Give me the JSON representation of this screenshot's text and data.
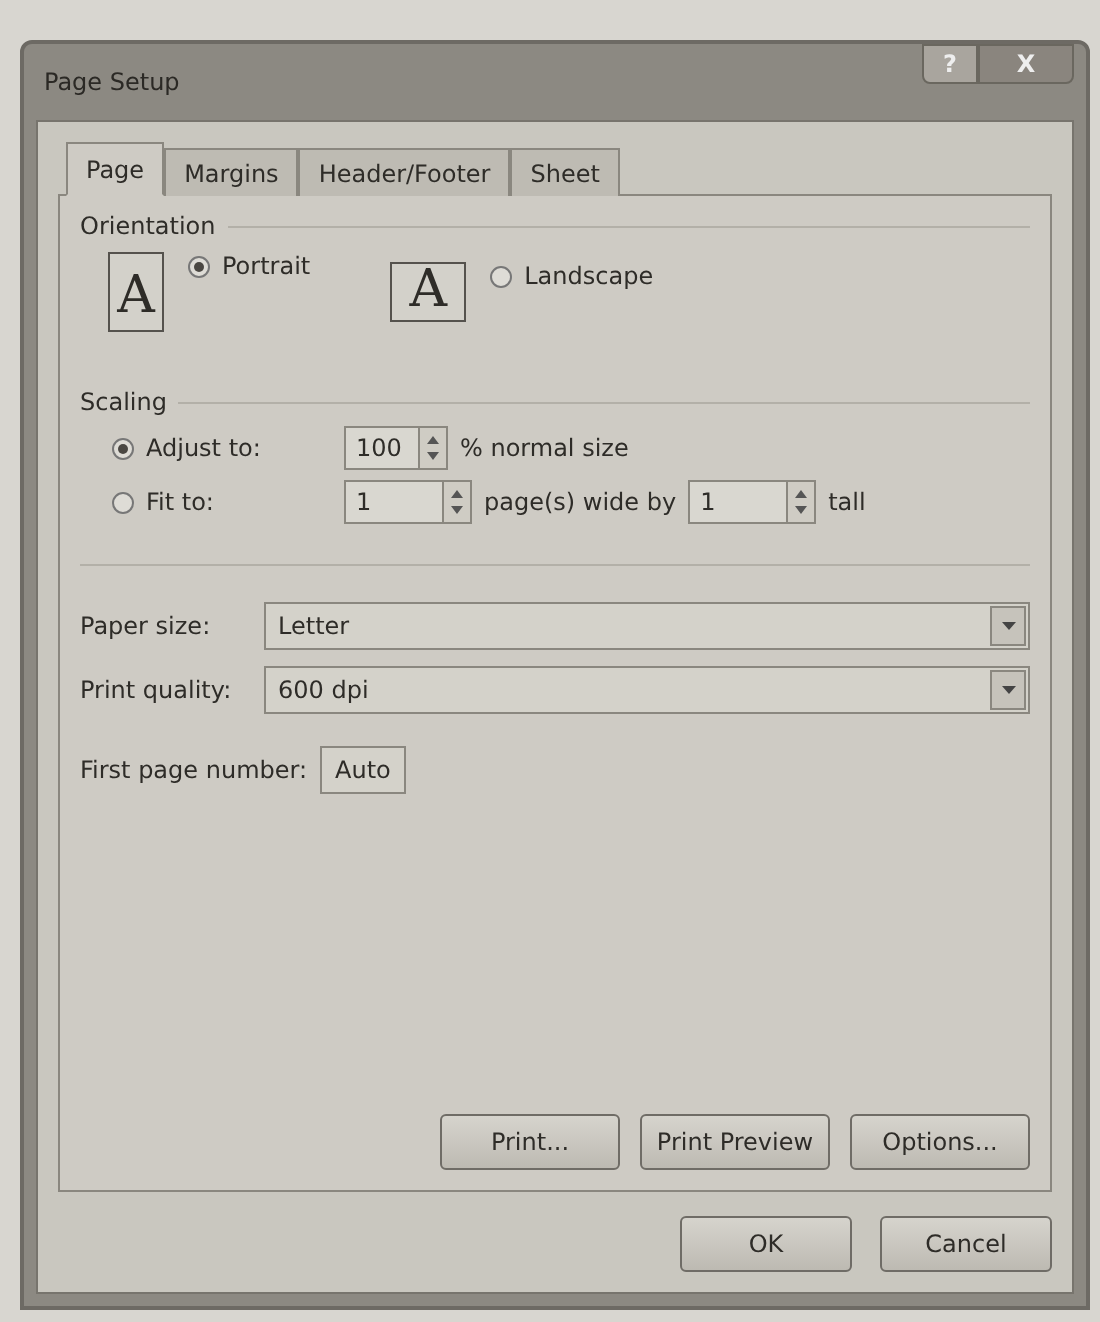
{
  "window": {
    "title": "Page Setup",
    "help_button": "?",
    "close_button": "X"
  },
  "tabs": [
    {
      "label": "Page",
      "selected": true
    },
    {
      "label": "Margins",
      "selected": false
    },
    {
      "label": "Header/Footer",
      "selected": false
    },
    {
      "label": "Sheet",
      "selected": false
    }
  ],
  "orientation": {
    "label": "Orientation",
    "options": [
      {
        "label": "Portrait",
        "kind": "portrait",
        "icon_letter": "A",
        "selected": true
      },
      {
        "label": "Landscape",
        "kind": "landscape",
        "icon_letter": "A",
        "selected": false
      }
    ]
  },
  "scaling": {
    "label": "Scaling",
    "options": [
      {
        "label": "Adjust to:",
        "selected": true,
        "parts": [
          {
            "kind": "field",
            "value": "100"
          },
          {
            "kind": "text",
            "text": "% normal size"
          }
        ]
      },
      {
        "label": "Fit to:",
        "selected": false,
        "parts": [
          {
            "kind": "field",
            "value": "1"
          },
          {
            "kind": "text",
            "text": "page(s) wide by"
          },
          {
            "kind": "field",
            "value": "1"
          },
          {
            "kind": "text",
            "text": "tall"
          }
        ]
      }
    ]
  },
  "paper_size": {
    "label": "Paper size:",
    "value": "Letter"
  },
  "print_quality": {
    "label": "Print quality:",
    "value": "600 dpi"
  },
  "first_page_number": {
    "label": "First page number:",
    "value": "Auto"
  },
  "panel_buttons": [
    "Print...",
    "Print Preview",
    "Options..."
  ],
  "dialog_buttons": [
    "OK",
    "Cancel"
  ]
}
